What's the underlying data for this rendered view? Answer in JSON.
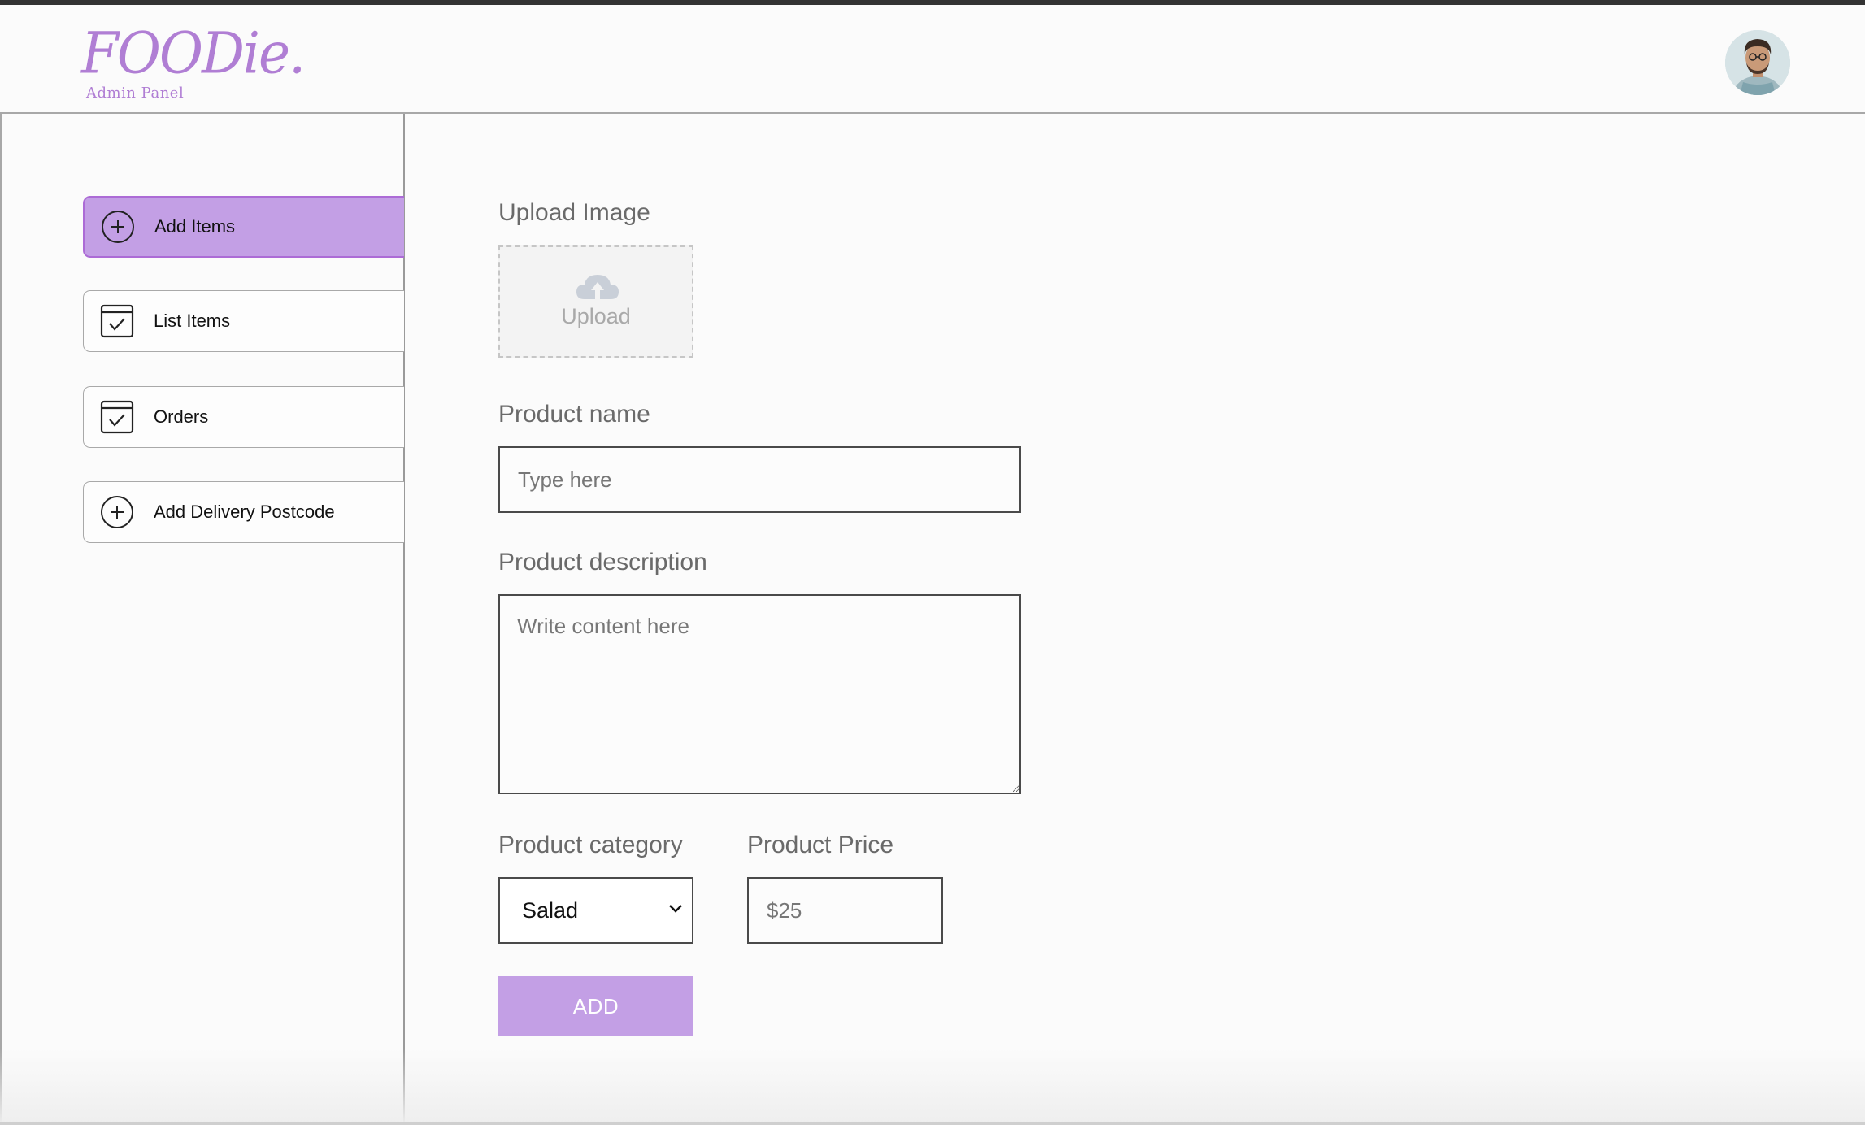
{
  "header": {
    "logo_text": "FOODie.",
    "logo_subtitle": "Admin Panel",
    "avatar_icon": "user-avatar"
  },
  "sidebar": {
    "items": [
      {
        "label": "Add Items",
        "icon": "plus-circle-icon",
        "active": true
      },
      {
        "label": "List Items",
        "icon": "calendar-check-icon",
        "active": false
      },
      {
        "label": "Orders",
        "icon": "calendar-check-icon",
        "active": false
      },
      {
        "label": "Add Delivery Postcode",
        "icon": "plus-circle-icon",
        "active": false
      }
    ]
  },
  "form": {
    "upload_label": "Upload Image",
    "upload_text": "Upload",
    "name_label": "Product name",
    "name_placeholder": "Type here",
    "description_label": "Product description",
    "description_placeholder": "Write content here",
    "category_label": "Product category",
    "category_value": "Salad",
    "price_label": "Product Price",
    "price_placeholder": "$25",
    "submit_label": "ADD"
  },
  "colors": {
    "accent": "#c39fe5",
    "accent_border": "#ac6bd6",
    "logo": "#b07ed4"
  }
}
